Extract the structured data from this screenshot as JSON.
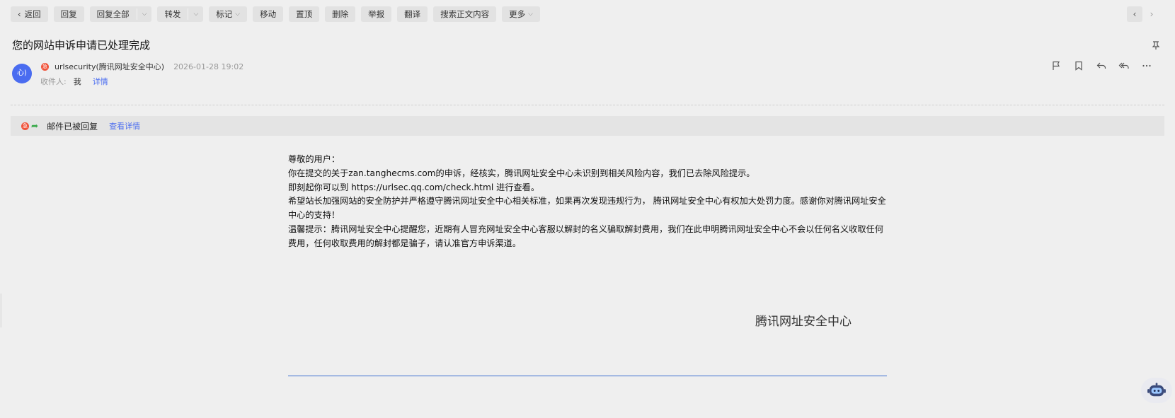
{
  "toolbar": {
    "back": "返回",
    "reply": "回复",
    "reply_all": "回复全部",
    "forward": "转发",
    "mark": "标记",
    "move": "移动",
    "pin_top": "置顶",
    "delete": "删除",
    "report": "举报",
    "translate": "翻译",
    "search_body": "搜索正文内容",
    "more": "更多"
  },
  "subject": "您的网站申诉申请已处理完成",
  "sender": {
    "avatar_text": "心)",
    "badge": "急",
    "name": "urlsecurity(腾讯网址安全中心)",
    "date": "2026-01-28 19:02",
    "recipient_label": "收件人:",
    "recipient": "我",
    "detail_link": "详情"
  },
  "banner": {
    "badge": "急",
    "text": "邮件已被回复",
    "link": "查看详情"
  },
  "body": {
    "lines": [
      "尊敬的用户：",
      "你在提交的关于zan.tanghecms.com的申诉，经核实，腾讯网址安全中心未识别到相关风险内容，我们已去除风险提示。",
      "即刻起你可以到 https://urlsec.qq.com/check.html 进行查看。",
      "希望站长加强网站的安全防护并严格遵守腾讯网址安全中心相关标准，如果再次发现违规行为， 腾讯网址安全中心有权加大处罚力度。感谢你对腾讯网址安全中心的支持！",
      "温馨提示：腾讯网址安全中心提醒您，近期有人冒充网址安全中心客服以解封的名义骗取解封费用，我们在此申明腾讯网址安全中心不会以任何名义收取任何费用，任何收取费用的解封都是骗子，请认准官方申诉渠道。"
    ],
    "signature": "腾讯网址安全中心"
  },
  "colors": {
    "accent": "#4a6cf0",
    "badge": "#f0533a",
    "reply_green": "#3aaa4b",
    "divider_blue": "#3b6fd0"
  }
}
